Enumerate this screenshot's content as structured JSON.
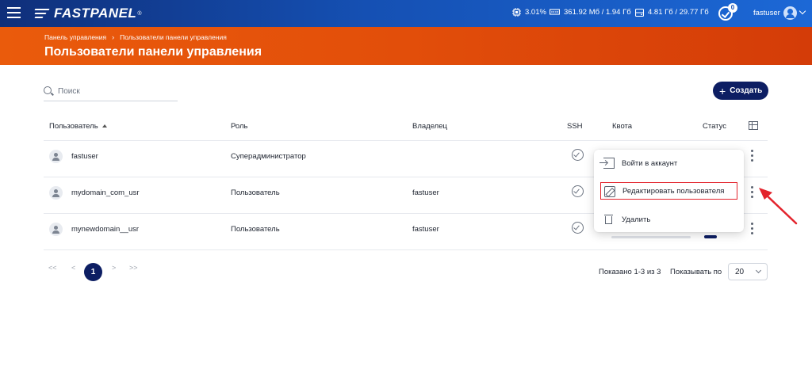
{
  "header": {
    "brand": "FASTPANEL",
    "brand_mark": "®",
    "cpu": "3.01%",
    "ram": "361.92 Мб / 1.94 Гб",
    "disk": "4.81 Гб / 29.77 Гб",
    "notifications_count": "0",
    "username": "fastuser"
  },
  "hero": {
    "breadcrumb_root": "Панель управления",
    "breadcrumb_sep": "›",
    "breadcrumb_current": "Пользователи панели управления",
    "title": "Пользователи панели управления"
  },
  "toolbar": {
    "search_placeholder": "Поиск",
    "create_label": "Создать"
  },
  "table": {
    "columns": [
      "Пользователь",
      "Роль",
      "Владелец",
      "SSH",
      "Квота",
      "Статус"
    ],
    "rows": [
      {
        "user": "fastuser",
        "role": "Суперадминистратор",
        "owner": ""
      },
      {
        "user": "mydomain_com_usr",
        "role": "Пользователь",
        "owner": "fastuser"
      },
      {
        "user": "mynewdomain__usr",
        "role": "Пользователь",
        "owner": "fastuser"
      }
    ]
  },
  "context_menu": {
    "items": [
      "Войти в аккаунт",
      "Редактировать пользователя",
      "Удалить"
    ],
    "highlighted_index": 1
  },
  "pagination": {
    "first": "<<",
    "prev": "<",
    "current": "1",
    "next": ">",
    "last": ">>",
    "shown": "Показано 1-3 из 3",
    "per_page_label": "Показывать по",
    "per_page_value": "20"
  },
  "colors": {
    "topbar": "#1550b3",
    "hero": "#e24e0a",
    "primary_button": "#0d1e63",
    "highlight_border": "#e3232c"
  }
}
